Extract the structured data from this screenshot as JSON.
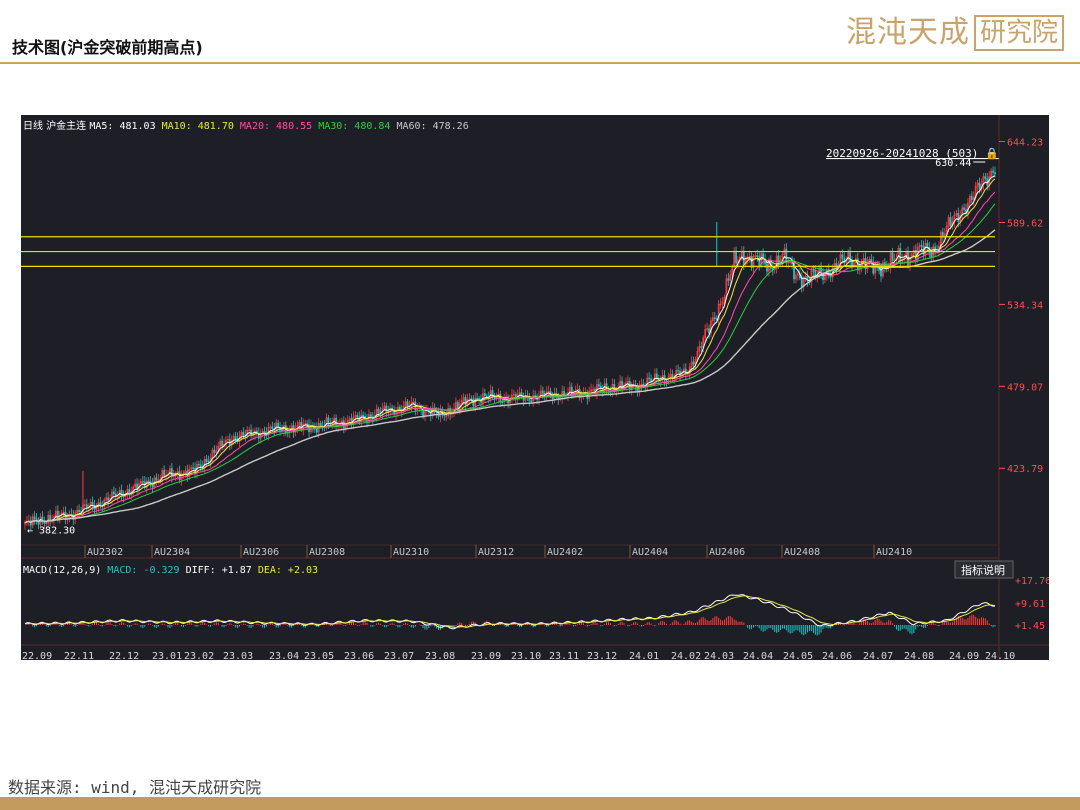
{
  "header": {
    "title": "技术图(沪金突破前期高点)"
  },
  "logo": {
    "main": "混沌天成",
    "boxed": "研究院"
  },
  "footer": {
    "source": "数据来源: wind, 混沌天成研究院"
  },
  "colors": {
    "gold": "#c9a46a",
    "up": "#ff3d3d",
    "down": "#19c6c6",
    "panel_bg": "#1d1e26",
    "ma5": "#ffffff",
    "ma10": "#e8e84a",
    "ma20": "#ff4da6",
    "ma30": "#2ecc40",
    "ma60": "#c9c9c9",
    "hline": "#e8e000"
  },
  "chart_data": {
    "type": "candlestick",
    "instrument": "沪金主连",
    "period": "日线",
    "range_label": "20220926-20241028 (503)",
    "ma_legend": [
      {
        "name": "MA5",
        "value": "481.03",
        "color": "#ffffff"
      },
      {
        "name": "MA10",
        "value": "481.70",
        "color": "#e8e84a"
      },
      {
        "name": "MA20",
        "value": "480.55",
        "color": "#ff4da6"
      },
      {
        "name": "MA30",
        "value": "480.84",
        "color": "#2ecc40"
      },
      {
        "name": "MA60",
        "value": "478.26",
        "color": "#c9c9c9"
      }
    ],
    "price_ticks": [
      "644.23",
      "589.62",
      "534.34",
      "479.07",
      "423.79"
    ],
    "ylim": [
      372,
      650
    ],
    "annotations": {
      "high": "630.44",
      "low": "382.30"
    },
    "resistance_levels": [
      580,
      570,
      560
    ],
    "contract_labels": [
      "AU2302",
      "AU2304",
      "AU2306",
      "AU2308",
      "AU2310",
      "AU2312",
      "AU2402",
      "AU2404",
      "AU2406",
      "AU2408",
      "AU2410"
    ],
    "date_labels": [
      "22.09",
      "22.11",
      "22.12",
      "23.01",
      "23.02",
      "23.03",
      "23.04",
      "23.05",
      "23.06",
      "23.07",
      "23.08",
      "23.09",
      "23.10",
      "23.11",
      "23.12",
      "24.01",
      "24.02",
      "24.03",
      "24.04",
      "24.05",
      "24.06",
      "24.07",
      "24.08",
      "24.09",
      "24.10"
    ],
    "price_path": [
      [
        0,
        386
      ],
      [
        12,
        390
      ],
      [
        22,
        392
      ],
      [
        38,
        400
      ],
      [
        52,
        408
      ],
      [
        60,
        412
      ],
      [
        70,
        418
      ],
      [
        78,
        420
      ],
      [
        88,
        422
      ],
      [
        98,
        435
      ],
      [
        108,
        445
      ],
      [
        118,
        447
      ],
      [
        128,
        450
      ],
      [
        140,
        451
      ],
      [
        155,
        453
      ],
      [
        170,
        456
      ],
      [
        185,
        462
      ],
      [
        200,
        466
      ],
      [
        210,
        462
      ],
      [
        215,
        459
      ],
      [
        222,
        465
      ],
      [
        235,
        472
      ],
      [
        250,
        471
      ],
      [
        270,
        473
      ],
      [
        290,
        475
      ],
      [
        305,
        479
      ],
      [
        315,
        479
      ],
      [
        330,
        485
      ],
      [
        342,
        488
      ],
      [
        348,
        502
      ],
      [
        355,
        520
      ],
      [
        362,
        543
      ],
      [
        367,
        562
      ],
      [
        372,
        568
      ],
      [
        377,
        565
      ],
      [
        385,
        560
      ],
      [
        392,
        567
      ],
      [
        398,
        556
      ],
      [
        405,
        551
      ],
      [
        412,
        555
      ],
      [
        420,
        560
      ],
      [
        427,
        566
      ],
      [
        432,
        562
      ],
      [
        440,
        559
      ],
      [
        447,
        562
      ],
      [
        455,
        567
      ],
      [
        462,
        570
      ],
      [
        470,
        571
      ],
      [
        475,
        581
      ],
      [
        480,
        590
      ],
      [
        485,
        599
      ],
      [
        490,
        605
      ],
      [
        496,
        618
      ],
      [
        502,
        627
      ]
    ],
    "macd": {
      "label": "MACD(12,26,9)",
      "values": [
        {
          "name": "MACD",
          "value": "-0.329",
          "color": "#19c6c6"
        },
        {
          "name": "DIFF",
          "value": "+1.87",
          "color": "#ffffff"
        },
        {
          "name": "DEA",
          "value": "+2.03",
          "color": "#e8e84a"
        }
      ],
      "ticks": [
        "+17.76",
        "+9.61",
        "+1.45"
      ],
      "button": "指标说明",
      "diff_path": [
        [
          0,
          0.6
        ],
        [
          25,
          1.0
        ],
        [
          50,
          2.2
        ],
        [
          75,
          1.2
        ],
        [
          100,
          2.0
        ],
        [
          125,
          0.9
        ],
        [
          150,
          0.3
        ],
        [
          175,
          2.2
        ],
        [
          200,
          1.9
        ],
        [
          220,
          -1.5
        ],
        [
          240,
          0.7
        ],
        [
          265,
          0.5
        ],
        [
          290,
          1.6
        ],
        [
          310,
          2.8
        ],
        [
          325,
          3.4
        ],
        [
          345,
          6.5
        ],
        [
          368,
          15.5
        ],
        [
          380,
          12.5
        ],
        [
          395,
          7.5
        ],
        [
          412,
          -0.5
        ],
        [
          430,
          2.0
        ],
        [
          447,
          6.2
        ],
        [
          460,
          0.5
        ],
        [
          477,
          2.2
        ],
        [
          495,
          11.0
        ],
        [
          502,
          9.8
        ]
      ]
    }
  }
}
